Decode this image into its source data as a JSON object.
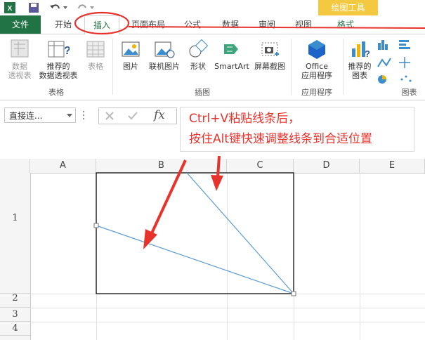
{
  "titlebar": {
    "context_tab": "绘图工具"
  },
  "tabs": [
    "文件",
    "开始",
    "插入",
    "页面布局",
    "公式",
    "数据",
    "审阅",
    "视图",
    "格式"
  ],
  "ribbon": {
    "pivot_table": "数据\n透视表",
    "recommended_pivot": "推荐的\n数据透视表",
    "table": "表格",
    "group_tables": "表格",
    "picture": "图片",
    "online_picture": "联机图片",
    "shapes": "形状",
    "smartart": "SmartArt",
    "screenshot": "屏幕截图",
    "group_illustrations": "插图",
    "office_apps": "Office\n应用程序",
    "group_apps": "应用程序",
    "recommended_charts": "推荐的\n图表",
    "group_charts": "图表"
  },
  "formula_bar": {
    "name_box": "直接连...",
    "fx": "fx"
  },
  "callout": {
    "line1": "Ctrl+V粘贴线条后，",
    "line2": "按住Alt键快速调整线条到合适位置"
  },
  "columns": [
    "A",
    "B",
    "C",
    "D",
    "E"
  ],
  "rows": [
    "1",
    "2",
    "3",
    "4"
  ],
  "colors": {
    "accent": "#217346",
    "callout_text": "#e8322c",
    "line": "#5b9bd5",
    "arrow": "#e8322c"
  }
}
